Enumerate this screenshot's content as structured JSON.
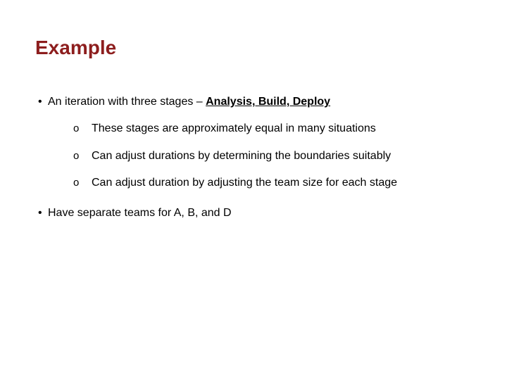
{
  "title": "Example",
  "bullets": {
    "b1_prefix": "An iteration with three stages – ",
    "b1_emph": "Analysis, Build, Deploy",
    "subs": [
      "These stages are approximately equal in many situations",
      "Can adjust durations by determining the boundaries suitably",
      "Can adjust duration by adjusting the team size for each stage"
    ],
    "b2": "Have separate teams for A, B, and D"
  }
}
